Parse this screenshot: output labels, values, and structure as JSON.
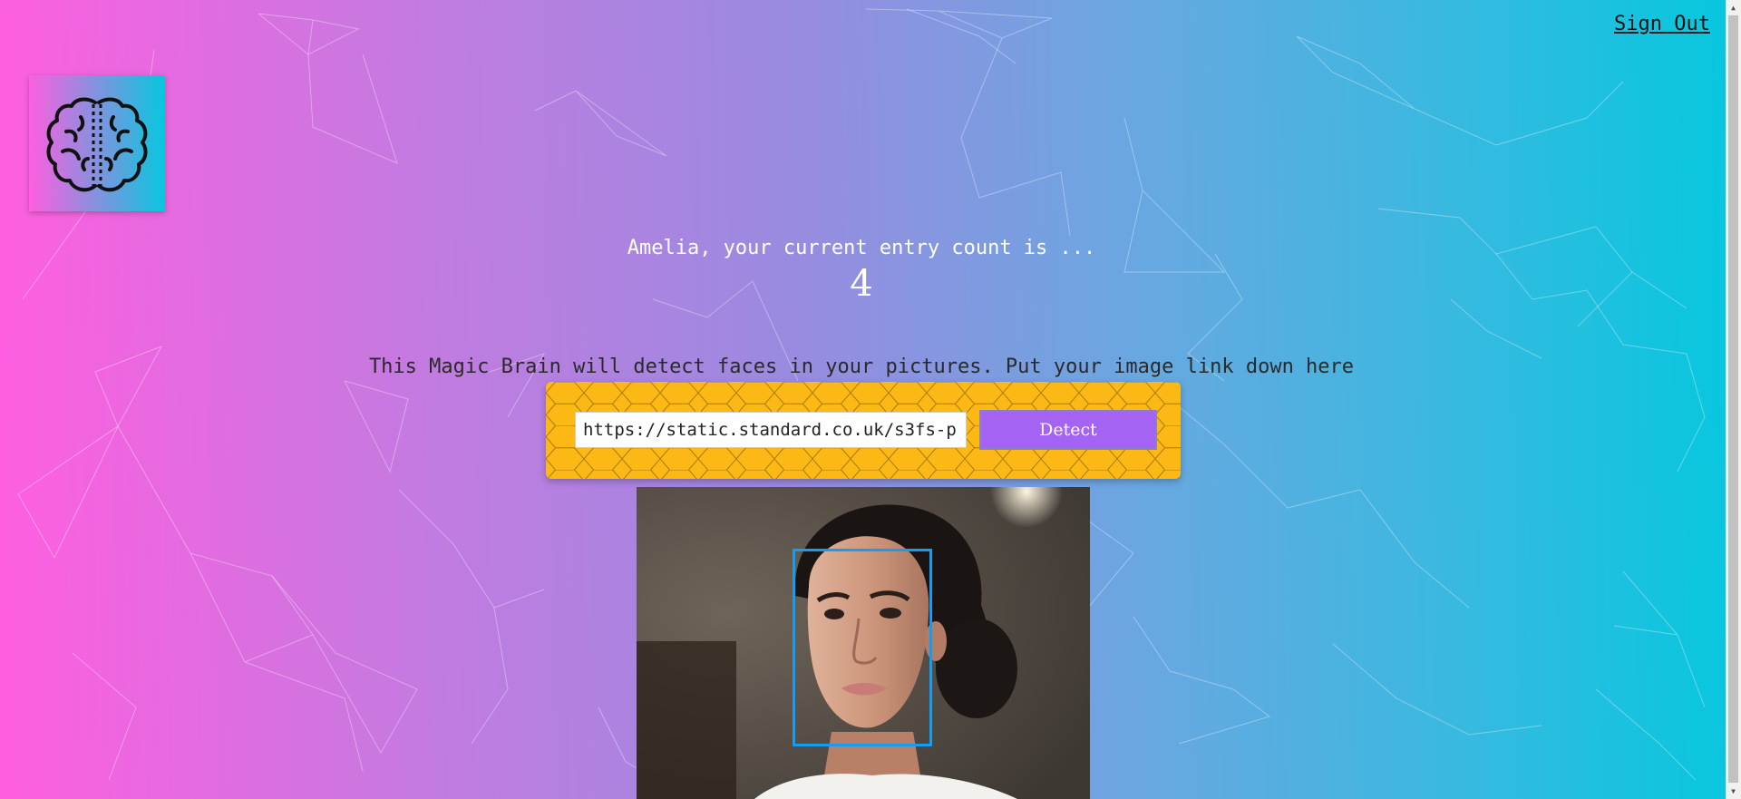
{
  "nav": {
    "sign_out_label": "Sign Out"
  },
  "logo": {
    "icon": "brain-icon"
  },
  "rank": {
    "message": "Amelia, your current entry count is ...",
    "count": "4"
  },
  "instructions": "This Magic Brain will detect faces in your pictures. Put your image link down here",
  "form": {
    "input_value": "https://static.standard.co.uk/s3fs-p",
    "detect_label": "Detect"
  },
  "colors": {
    "gradient_start": "#ff5edf",
    "gradient_end": "#04c8de",
    "panel": "#fcb814",
    "button": "#a463f2",
    "bounding_box": "#149df2"
  }
}
